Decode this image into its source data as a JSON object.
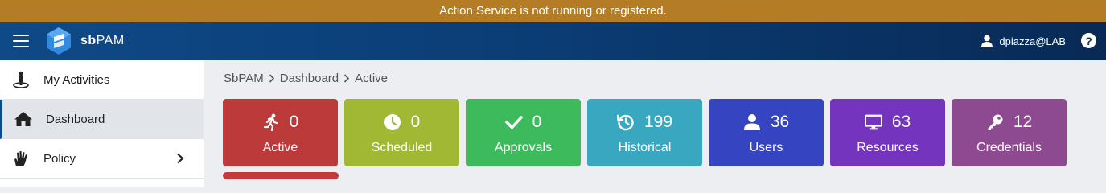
{
  "banner": {
    "text": "Action Service is not running or registered."
  },
  "header": {
    "brand_bold": "sb",
    "brand_rest": "PAM",
    "user": "dpiazza@LAB",
    "help": "?"
  },
  "sidebar": {
    "items": [
      {
        "label": "My Activities",
        "icon": "activity-person-icon"
      },
      {
        "label": "Dashboard",
        "icon": "home-icon",
        "active": true
      },
      {
        "label": "Policy",
        "icon": "hand-icon",
        "has_children": true
      }
    ]
  },
  "breadcrumb": [
    "SbPAM",
    "Dashboard",
    "Active"
  ],
  "cards": [
    {
      "label": "Active",
      "count": "0",
      "icon": "running-icon",
      "color": "#bd3a3a"
    },
    {
      "label": "Scheduled",
      "count": "0",
      "icon": "clock-icon",
      "color": "#a0b834"
    },
    {
      "label": "Approvals",
      "count": "0",
      "icon": "checkmark-icon",
      "color": "#3dba5c"
    },
    {
      "label": "Historical",
      "count": "199",
      "icon": "history-icon",
      "color": "#3aa7c1"
    },
    {
      "label": "Users",
      "count": "36",
      "icon": "user-icon",
      "color": "#3544c0"
    },
    {
      "label": "Resources",
      "count": "63",
      "icon": "monitor-icon",
      "color": "#7434be"
    },
    {
      "label": "Credentials",
      "count": "12",
      "icon": "key-icon",
      "color": "#8e4a90"
    }
  ],
  "colors": {
    "banner": "#b47d25",
    "header": "#0b3c74",
    "active_underline": "#c43b3b"
  }
}
